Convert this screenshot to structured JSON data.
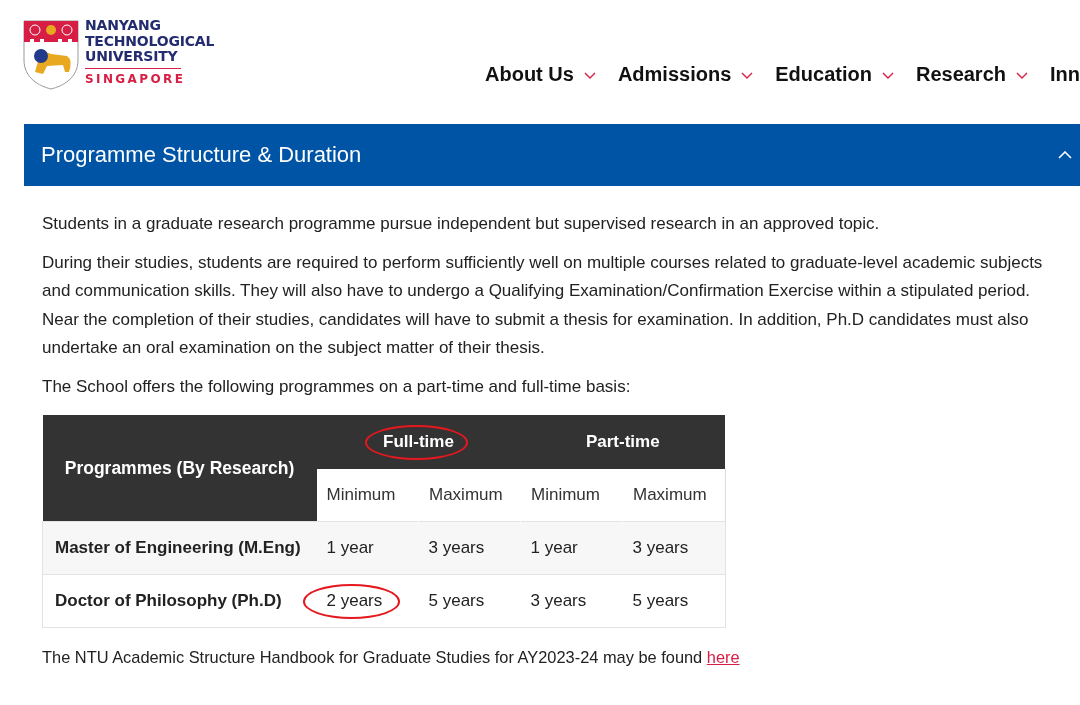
{
  "header": {
    "logo": {
      "lines": [
        "NANYANG",
        "TECHNOLOGICAL",
        "UNIVERSITY"
      ],
      "subtitle": "SINGAPORE"
    },
    "nav": [
      {
        "label": "About Us",
        "has_dropdown": true
      },
      {
        "label": "Admissions",
        "has_dropdown": true
      },
      {
        "label": "Education",
        "has_dropdown": true
      },
      {
        "label": "Research",
        "has_dropdown": true
      },
      {
        "label": "Inn",
        "has_dropdown": false
      }
    ]
  },
  "panel": {
    "title": "Programme Structure & Duration",
    "expanded": true,
    "paragraphs": [
      "Students in a graduate research programme pursue independent but supervised research in an approved topic.",
      "During their studies, students are required to perform sufficiently well on multiple courses related to graduate-level academic subjects and communication skills. They will also have to undergo a Qualifying Examination/Confirmation Exercise within a stipulated period. Near the completion of their studies, candidates will have to submit a thesis for examination. In addition, Ph.D candidates must also undertake an oral examination on the subject matter of their thesis.",
      "The School offers the following programmes on a part-time and full-time basis:"
    ],
    "table": {
      "corner": "Programmes (By Research)",
      "groups": [
        {
          "label": "Full-time",
          "circled": true
        },
        {
          "label": "Part-time",
          "circled": false
        }
      ],
      "subcolumns": [
        "Minimum",
        "Maximum",
        "Minimum",
        "Maximum"
      ],
      "rows": [
        {
          "name": "Master of Engineering (M.Eng)",
          "cells": [
            {
              "text": "1 year",
              "circled": false
            },
            {
              "text": "3 years",
              "circled": false
            },
            {
              "text": "1 year",
              "circled": false
            },
            {
              "text": "3 years",
              "circled": false
            }
          ]
        },
        {
          "name": "Doctor of Philosophy (Ph.D)",
          "cells": [
            {
              "text": "2 years",
              "circled": true
            },
            {
              "text": "5 years",
              "circled": false
            },
            {
              "text": "3 years",
              "circled": false
            },
            {
              "text": "5 years",
              "circled": false
            }
          ]
        }
      ]
    },
    "footer": {
      "text": "The NTU Academic Structure Handbook for Graduate Studies for AY2023-24 may be found",
      "link": "here"
    }
  }
}
